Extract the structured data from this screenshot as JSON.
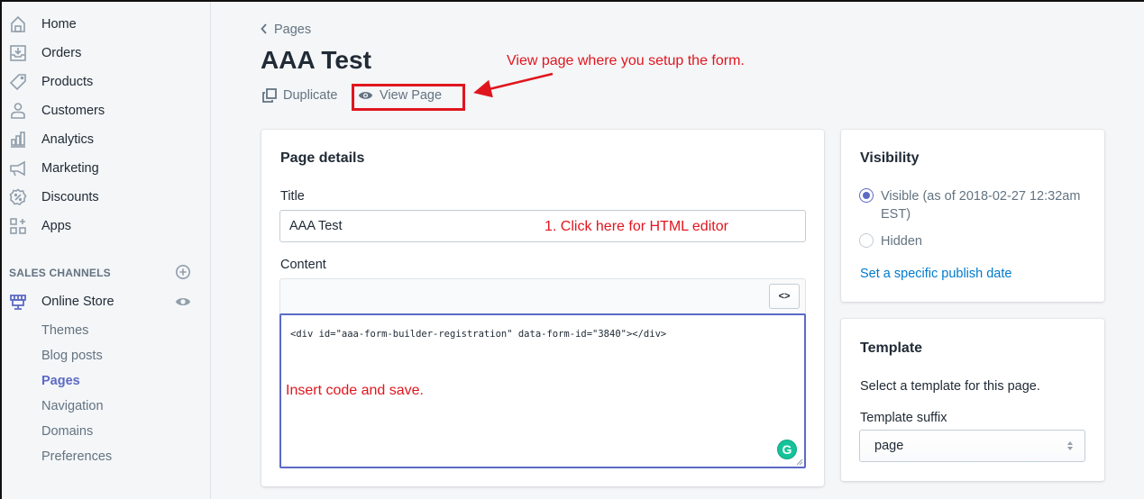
{
  "sidebar": {
    "nav": [
      {
        "label": "Home",
        "icon": "home-icon"
      },
      {
        "label": "Orders",
        "icon": "orders-icon"
      },
      {
        "label": "Products",
        "icon": "tag-icon"
      },
      {
        "label": "Customers",
        "icon": "person-icon"
      },
      {
        "label": "Analytics",
        "icon": "bar-chart-icon"
      },
      {
        "label": "Marketing",
        "icon": "megaphone-icon"
      },
      {
        "label": "Discounts",
        "icon": "discount-icon"
      },
      {
        "label": "Apps",
        "icon": "apps-icon"
      }
    ],
    "sales_channels_title": "SALES CHANNELS",
    "online_store": {
      "label": "Online Store",
      "icon": "store-icon"
    },
    "sub_items": [
      {
        "label": "Themes",
        "active": false
      },
      {
        "label": "Blog posts",
        "active": false
      },
      {
        "label": "Pages",
        "active": true
      },
      {
        "label": "Navigation",
        "active": false
      },
      {
        "label": "Domains",
        "active": false
      },
      {
        "label": "Preferences",
        "active": false
      }
    ]
  },
  "header": {
    "breadcrumb": "Pages",
    "title": "AAA Test",
    "actions": {
      "duplicate": "Duplicate",
      "view_page": "View Page"
    }
  },
  "annotations": {
    "view_page": "View page where you setup the form.",
    "html_editor": "1. Click here for HTML editor",
    "insert_code": "Insert code and save."
  },
  "page_details": {
    "title": "Page details",
    "title_label": "Title",
    "title_value": "AAA Test",
    "content_label": "Content",
    "html_toggle": "<>",
    "code": "<div id=\"aaa-form-builder-registration\" data-form-id=\"3840\"></div>",
    "grammarly": "G"
  },
  "visibility": {
    "title": "Visibility",
    "options": [
      {
        "label": "Visible (as of 2018-02-27 12:32am EST)",
        "checked": true
      },
      {
        "label": "Hidden",
        "checked": false
      }
    ],
    "publish_link": "Set a specific publish date"
  },
  "template": {
    "title": "Template",
    "description": "Select a template for this page.",
    "suffix_label": "Template suffix",
    "suffix_value": "page"
  },
  "colors": {
    "accent": "#5c6ac4",
    "link": "#007ace",
    "annotation": "#e0161e",
    "background": "#f4f6f8"
  }
}
